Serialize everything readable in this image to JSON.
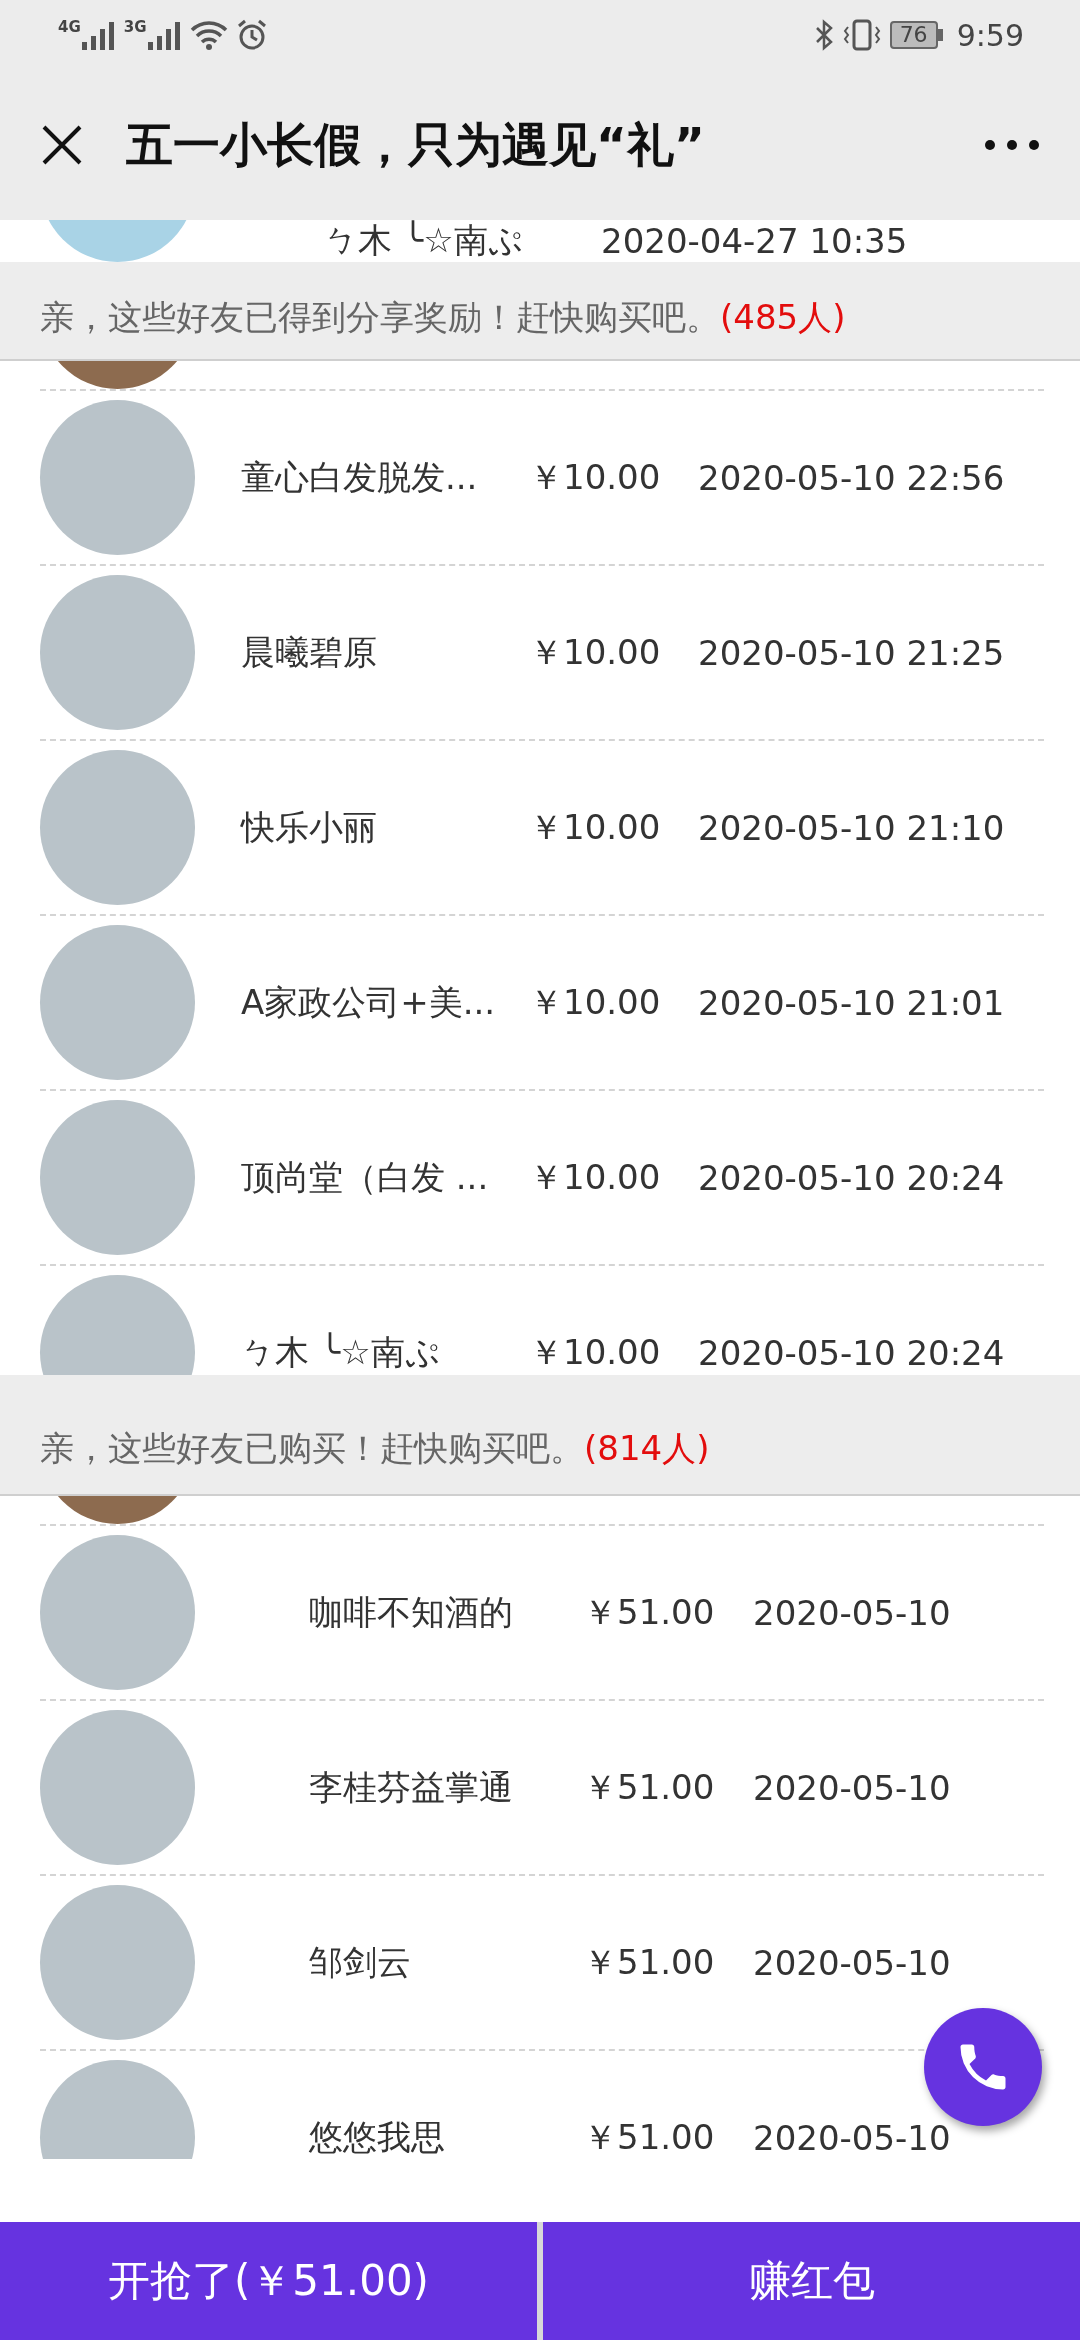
{
  "status_bar": {
    "network_1": "4G",
    "network_2": "3G",
    "battery": "76",
    "time": "9:59"
  },
  "title_bar": {
    "title": "五一小长假，只为遇见“礼”"
  },
  "previous_row": {
    "name": "ㄅ木 ╰☆南ぷ",
    "time": "2020-04-27 10:35"
  },
  "sections": [
    {
      "kind": "reward",
      "notice": "亲，这些好友已得到分享奖励！赶快购买吧。",
      "count": "(485人)",
      "rows": [
        {
          "name": "童心白发脱发...",
          "price": "￥10.00",
          "time": "2020-05-10 22:56"
        },
        {
          "name": "晨曦碧原",
          "price": "￥10.00",
          "time": "2020-05-10 21:25"
        },
        {
          "name": "快乐小丽",
          "price": "￥10.00",
          "time": "2020-05-10 21:10"
        },
        {
          "name": "A家政公司+美...",
          "price": "￥10.00",
          "time": "2020-05-10 21:01"
        },
        {
          "name": "顶尚堂（白发 ...",
          "price": "￥10.00",
          "time": "2020-05-10 20:24"
        },
        {
          "name": "ㄅ木 ╰☆南ぷ",
          "price": "￥10.00",
          "time": "2020-05-10 20:24"
        }
      ]
    },
    {
      "kind": "purchase",
      "notice": "亲，这些好友已购买！赶快购买吧。",
      "count": "(814人)",
      "rows": [
        {
          "name": "咖啡不知酒的",
          "price": "￥51.00",
          "time": "2020-05-10"
        },
        {
          "name": "李桂芬益掌通",
          "price": "￥51.00",
          "time": "2020-05-10"
        },
        {
          "name": "邹剑云",
          "price": "￥51.00",
          "time": "2020-05-10"
        },
        {
          "name": "悠悠我思",
          "price": "￥51.00",
          "time": "2020-05-10"
        }
      ]
    }
  ],
  "bottom_bar": {
    "buy_button": "开抢了(￥51.00)",
    "earn_button": "赚红包"
  }
}
